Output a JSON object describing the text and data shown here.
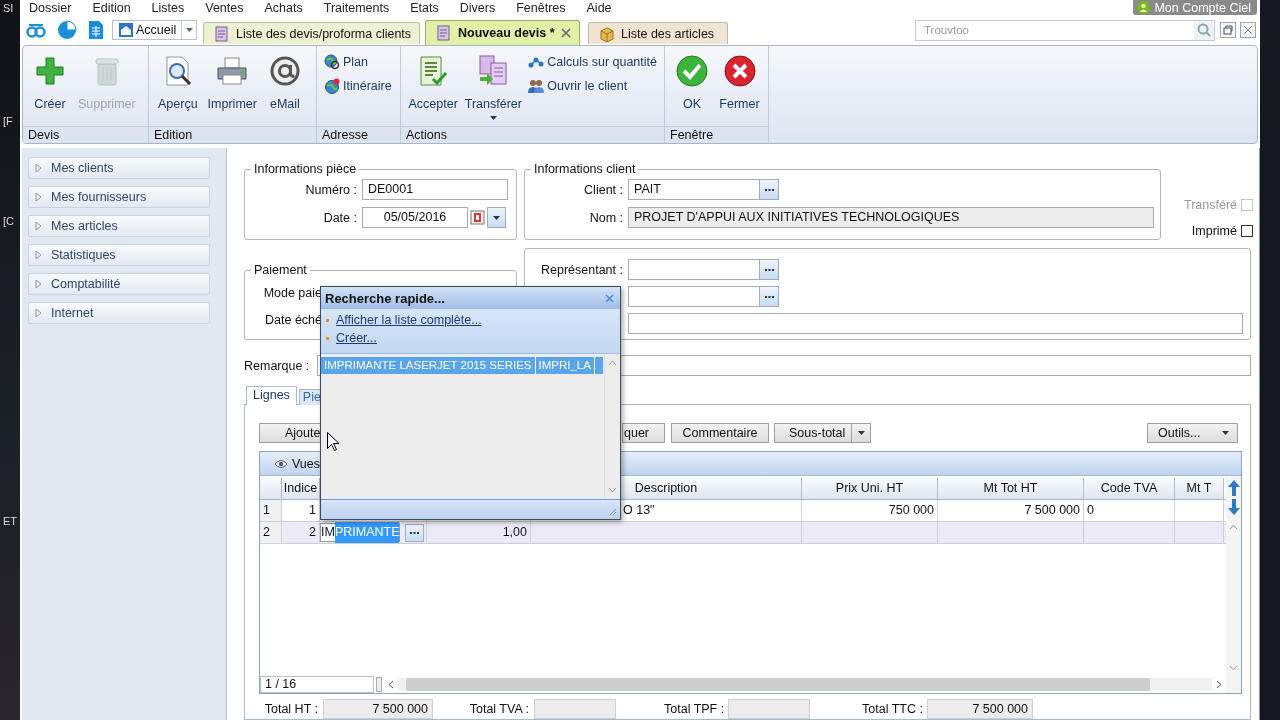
{
  "desktop_edge": [
    "SI",
    "[F",
    "[C",
    "ET"
  ],
  "account": "Mon Compte Ciel",
  "menu": [
    "Dossier",
    "Edition",
    "Listes",
    "Ventes",
    "Achats",
    "Traitements",
    "Etats",
    "Divers",
    "Fenêtres",
    "Aide"
  ],
  "home": {
    "label": "Accueil"
  },
  "tabs": [
    {
      "label": "Liste des devis/proforma clients",
      "selected": false,
      "color": "#eef0d2"
    },
    {
      "label": "Nouveau devis *",
      "selected": true,
      "color": "#e2efa6"
    },
    {
      "label": "Liste des articles",
      "selected": false,
      "color": "#f2e3d3"
    }
  ],
  "search": {
    "placeholder": "Trouvtoo"
  },
  "ribbon": [
    {
      "title": "Devis",
      "items": [
        {
          "label": "Créer",
          "kind": "large",
          "disabled": false,
          "dropdown": false
        },
        {
          "label": "Supprimer",
          "kind": "large",
          "disabled": true,
          "dropdown": false
        }
      ]
    },
    {
      "title": "Edition",
      "items": [
        {
          "label": "Aperçu",
          "kind": "large",
          "disabled": false,
          "dropdown": false
        },
        {
          "label": "Imprimer",
          "kind": "large",
          "disabled": false,
          "dropdown": false
        },
        {
          "label": "eMail",
          "kind": "large",
          "disabled": false,
          "dropdown": false
        }
      ]
    },
    {
      "title": "Adresse",
      "items": [
        {
          "label": "Plan",
          "kind": "small",
          "disabled": false,
          "dropdown": false
        },
        {
          "label": "Itinéraire",
          "kind": "small",
          "disabled": false,
          "dropdown": false
        }
      ]
    },
    {
      "title": "Actions",
      "items": [
        {
          "label": "Accepter",
          "kind": "large",
          "disabled": false,
          "dropdown": false
        },
        {
          "label": "Transférer",
          "kind": "large",
          "disabled": false,
          "dropdown": true
        },
        {
          "label": "Calculs sur quantité",
          "kind": "small",
          "disabled": false,
          "dropdown": false
        },
        {
          "label": "Ouvrir le client",
          "kind": "small",
          "disabled": false,
          "dropdown": false
        }
      ]
    },
    {
      "title": "Fenêtre",
      "items": [
        {
          "label": "OK",
          "kind": "large",
          "disabled": false,
          "dropdown": false
        },
        {
          "label": "Fermer",
          "kind": "large",
          "disabled": false,
          "dropdown": false
        }
      ]
    }
  ],
  "sidebar": [
    {
      "label": "Mes clients",
      "expanded": false
    },
    {
      "label": "Mes fournisseurs",
      "expanded": false
    },
    {
      "label": "Mes articles",
      "expanded": false
    },
    {
      "label": "Statistiques",
      "expanded": false
    },
    {
      "label": "Comptabilité",
      "expanded": false
    },
    {
      "label": "Internet",
      "expanded": false
    }
  ],
  "piece": {
    "title": "Informations pièce",
    "number_label": "Numéro :",
    "number": "DE0001",
    "date_label": "Date :",
    "date": "05/05/2016"
  },
  "client": {
    "title": "Informations client",
    "client_label": "Client :",
    "client": "PAIT",
    "name_label": "Nom :",
    "name": "PROJET D'APPUI AUX INITIATIVES TECHNOLOGIQUES"
  },
  "flags": [
    {
      "label": "Transféré",
      "checked": false,
      "disabled": true
    },
    {
      "label": "Imprimé",
      "checked": false,
      "disabled": false
    }
  ],
  "payment": {
    "title": "Paiement",
    "labels": [
      "Mode paie",
      "Date éché"
    ]
  },
  "contact": {
    "representative_label": "Représentant :"
  },
  "remark_label": "Remarque :",
  "detail_tabs": [
    {
      "label": "Lignes",
      "selected": true
    },
    {
      "label": "Pie",
      "selected": false
    }
  ],
  "line_buttons": [
    {
      "label": "Ajoute",
      "dropdown": false
    },
    {
      "label": "quer",
      "dropdown": false
    },
    {
      "label": "Commentaire",
      "dropdown": false
    },
    {
      "label": "Sous-total",
      "dropdown": true
    }
  ],
  "tools_button": {
    "label": "Outils...",
    "dropdown": true
  },
  "views": "Vues",
  "grid": {
    "columns": [
      null,
      "Indice",
      null,
      null,
      "Description",
      "Prix Uni. HT",
      "Mt Tot HT",
      "Code TVA",
      "Mt T"
    ],
    "rows": [
      {
        "selected": false,
        "cells": [
          "1",
          "1",
          null,
          null,
          "O 13\"",
          "750 000",
          "7 500 000",
          "0",
          null
        ]
      },
      {
        "selected": true,
        "cells": [
          "2",
          "2",
          null,
          "1,00",
          null,
          null,
          null,
          null,
          null
        ],
        "editor": {
          "text": "IM",
          "selection": "PRIMANTE"
        }
      }
    ],
    "pager": "1 / 16"
  },
  "totals": [
    {
      "label": "Total HT :",
      "value": "7 500 000"
    },
    {
      "label": "Total TVA :"
    },
    {
      "label": "Total TPF :"
    },
    {
      "label": "Total TTC :",
      "value": "7 500 000"
    }
  ],
  "quick_search": {
    "title": "Recherche rapide...",
    "links": [
      "Afficher la liste complète...",
      "Créer..."
    ],
    "results": [
      {
        "selected": true,
        "cells": [
          "IMPRIMANTE LASERJET 2015 SERIES",
          "IMPRI_LA"
        ]
      }
    ]
  }
}
